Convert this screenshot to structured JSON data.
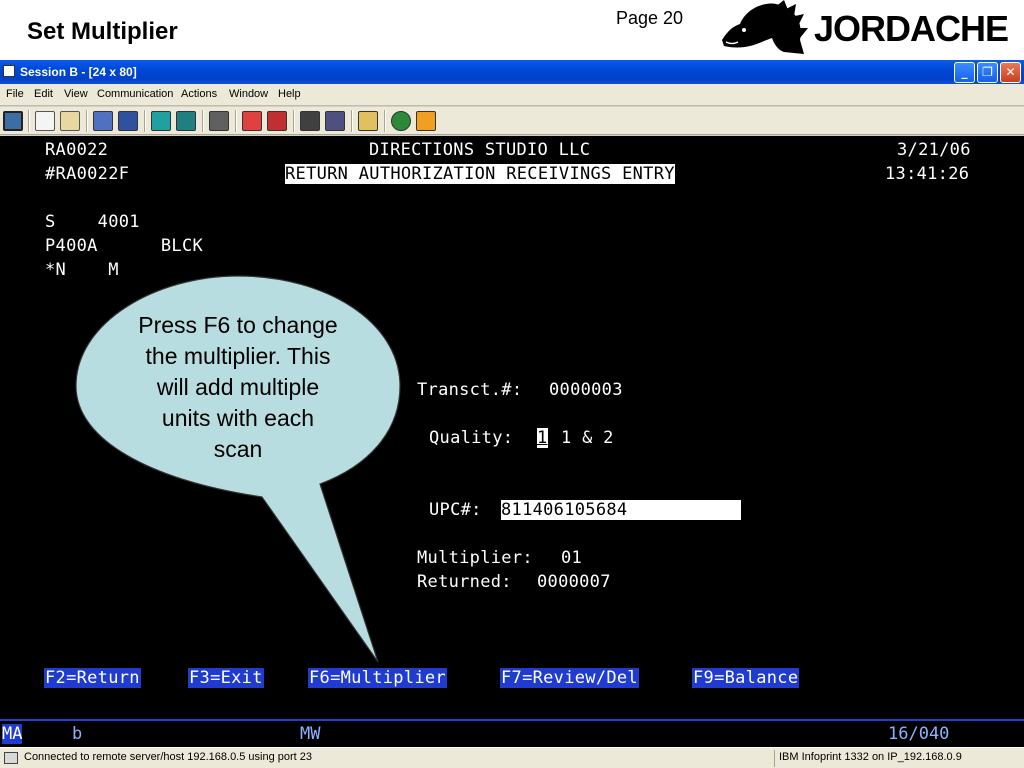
{
  "slide": {
    "title": "Set Multiplier",
    "page": "Page 20",
    "logo_text": "JORDACHE"
  },
  "window": {
    "title": "Session B - [24 x 80]",
    "controls": [
      "minimize",
      "restore",
      "close"
    ]
  },
  "menu": [
    "File",
    "Edit",
    "View",
    "Communication",
    "Actions",
    "Window",
    "Help"
  ],
  "toolbar_icons": [
    "print-screen-icon",
    "copy-icon",
    "paste-icon",
    "send-icon",
    "receive-icon",
    "display-icon",
    "keyboard-icon",
    "macro-icon",
    "record-icon",
    "playback-icon",
    "transfer-icon",
    "receive-file-icon",
    "clipboard-icon",
    "globe-icon",
    "help-icon"
  ],
  "terminal": {
    "program": "RA0022",
    "company": "DIRECTIONS STUDIO LLC",
    "date": "3/21/06",
    "screen_id": "#RA0022F",
    "screen_title": "RETURN AUTHORIZATION RECEIVINGS ENTRY",
    "time": "13:41:26",
    "line5": "S    4001",
    "line6": "P400A      BLCK",
    "line7": "*N    M",
    "transact_label": "Transct.#:",
    "transact_value": "0000003",
    "quality_label": "Quality:",
    "quality_value": "1",
    "quality_options": "1 & 2",
    "upc_label": "UPC#:",
    "upc_value": "811406105684",
    "multiplier_label": "Multiplier:",
    "multiplier_value": "01",
    "returned_label": "Returned:",
    "returned_value": "0000007",
    "fkeys": [
      "F2=Return",
      "F3=Exit",
      "F6=Multiplier",
      "F7=Review/Del",
      "F9=Balance"
    ]
  },
  "callout": {
    "lines": [
      "Press F6 to change",
      "the multiplier. This",
      "will add multiple",
      "units with each",
      "scan"
    ],
    "fill": "#b7dde0"
  },
  "oia": {
    "mode": "MA",
    "b": "b",
    "mw": "MW",
    "cursor": "16/040"
  },
  "status": {
    "connection": "Connected to remote server/host 192.168.0.5 using port 23",
    "printer": "IBM Infoprint 1332 on IP_192.168.0.9"
  },
  "colors": {
    "titlebar": "#0048d8",
    "terminal_bg": "#000000",
    "fkey_bg": "#1f3bd0",
    "oia_text": "#8fb0ff"
  }
}
